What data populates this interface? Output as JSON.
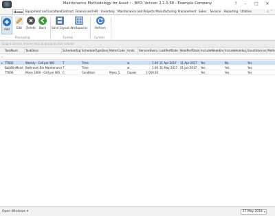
{
  "window": {
    "title": "Maintenance Methodology for Asset : - BPO: Version 2.1.0.58 - Example Company",
    "controls": [
      "?",
      "–",
      "□",
      "✕"
    ]
  },
  "tabs": [
    {
      "label": "Home",
      "active": true
    },
    {
      "label": "Equipment and Locations",
      "active": false
    },
    {
      "label": "Contract",
      "active": false
    },
    {
      "label": "Finance and HR",
      "active": false
    },
    {
      "label": "Inventory",
      "active": false
    },
    {
      "label": "Maintenance and Projects",
      "active": false
    },
    {
      "label": "Manufacturing",
      "active": false
    },
    {
      "label": "Procurement",
      "active": false
    },
    {
      "label": "Sales",
      "active": false
    },
    {
      "label": "Service",
      "active": false
    },
    {
      "label": "Reporting",
      "active": false
    },
    {
      "label": "Utilities",
      "active": false
    }
  ],
  "ribbon": {
    "buttons": {
      "add": "Add",
      "edit": "Edit",
      "delete": "Delete",
      "back": "Back",
      "save_layout": "Save Layout",
      "workspaces": "Workspaces",
      "refresh": "Refresh"
    },
    "groups": {
      "processing": "Processing",
      "format": "Format",
      "current": "Current"
    }
  },
  "groupby_hint": "Drag a column header here to group by that column",
  "grid": {
    "columns": [
      "TaskNum",
      "TaskDesc",
      "ScheduleType",
      "ScheduleTypeDesc",
      "MeterCode",
      "Units",
      "ServiceEvery",
      "LastPerfDate",
      "NextPerfDate",
      "IncludeWeekEnds",
      "IncludeHolidays",
      "ExactInterval",
      "Metho"
    ],
    "rows": [
      [
        "TT002",
        "Weekly - Call per WO",
        "T",
        "Time",
        "",
        "w",
        "1.00",
        "11 Apr 2017",
        "11 Apr 2017",
        "Yes",
        "No",
        "Yes",
        ""
      ],
      [
        "BathBinMaint",
        "Bathroom Bin Maintenance",
        "T",
        "Time",
        "",
        "w",
        "1.00",
        "31 May 2017",
        "01 Jun 2017",
        "Yes",
        "Yes",
        "Yes",
        ""
      ],
      [
        "TT006",
        "Mono 1000 - Call per WO",
        "C",
        "Condition",
        "Mono_5",
        "Copies",
        "1 000.00",
        "",
        "",
        "Yes",
        "Yes",
        "Yes",
        ""
      ]
    ],
    "selected_row": 0
  },
  "status": {
    "open_windows": "Open Windows ▾",
    "date": "17 May 2018"
  },
  "colors": {
    "accent": "#2f6fb0",
    "selection": "#cfe0f2",
    "add_icon": "#2d74b8",
    "back_icon": "#3c9a3c",
    "delete_icon": "#555555",
    "refresh_icon": "#3f7cc4"
  }
}
